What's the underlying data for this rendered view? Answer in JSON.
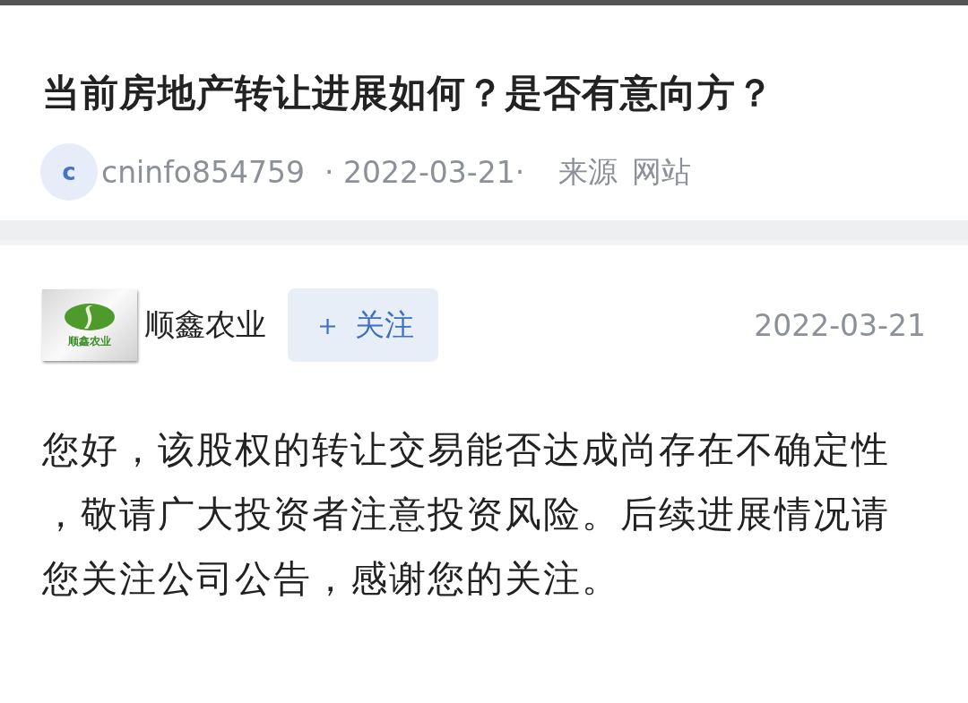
{
  "question": {
    "title": "当前房地产转让进展如何？是否有意向方？",
    "asker": {
      "avatar_letter": "c",
      "name": "cninfo854759",
      "date": "· 2022-03-21·",
      "source_label": "来源",
      "source": "网站"
    }
  },
  "answer": {
    "company": {
      "logo_text": "顺鑫农业",
      "name": "顺鑫农业"
    },
    "follow_button": {
      "icon": "＋",
      "label": "关注",
      "followed": false
    },
    "date": "2022-03-21",
    "body_lines": [
      "您好，该股权的转让交易能否达成尚存在不确定性",
      "，敬请广大投资者注意投资风险。后续进展情况请",
      "您关注公司公告，感谢您的关注。"
    ]
  }
}
